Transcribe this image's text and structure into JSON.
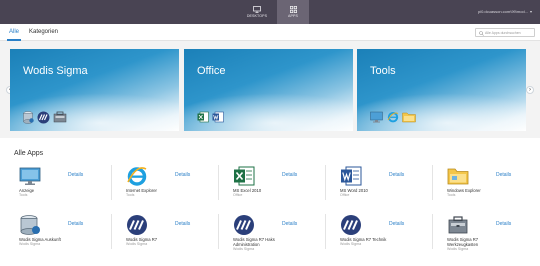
{
  "topbar": {
    "nav": [
      {
        "label": "DESKTOPS",
        "icon": "monitor-icon"
      },
      {
        "label": "APPS",
        "icon": "grid-icon",
        "active": true
      }
    ],
    "user": "pi0.dcuasson.com\\99\\mod..."
  },
  "tabs": [
    {
      "label": "Alle",
      "active": true
    },
    {
      "label": "Kategorien",
      "active": false
    }
  ],
  "search": {
    "placeholder": "Alle Apps durchsuchen"
  },
  "banners": [
    {
      "title": "Wodis Sigma"
    },
    {
      "title": "Office"
    },
    {
      "title": "Tools"
    }
  ],
  "section_title": "Alle Apps",
  "details_label": "Details",
  "apps": [
    {
      "name": "Anzeige",
      "category": "Tools",
      "icon": "display-settings-icon"
    },
    {
      "name": "Internet Explorer",
      "category": "Tools",
      "icon": "internet-explorer-icon"
    },
    {
      "name": "MS Excel 2010",
      "category": "Office",
      "icon": "excel-icon"
    },
    {
      "name": "MS Word 2010",
      "category": "Office",
      "icon": "word-icon"
    },
    {
      "name": "Windows Explorer",
      "category": "Tools",
      "icon": "folder-icon"
    },
    {
      "name": "Wodis Sigma Auskunft",
      "category": "Wodis Sigma",
      "icon": "database-icon"
    },
    {
      "name": "Wodis Sigma R7",
      "category": "Wodis Sigma",
      "icon": "wodis-logo-icon"
    },
    {
      "name": "Wodis Sigma R7 Haks Administration",
      "category": "Wodis Sigma",
      "icon": "wodis-logo-icon"
    },
    {
      "name": "Wodis Sigma R7 Technik",
      "category": "Wodis Sigma",
      "icon": "wodis-logo-icon"
    },
    {
      "name": "Wodis Sigma R7 Werkzeugkasten",
      "category": "Wodis Sigma",
      "icon": "toolbox-icon"
    }
  ],
  "colors": {
    "topbar": "#494453",
    "accent": "#2a7fc7",
    "banner": "#2e95cb"
  }
}
